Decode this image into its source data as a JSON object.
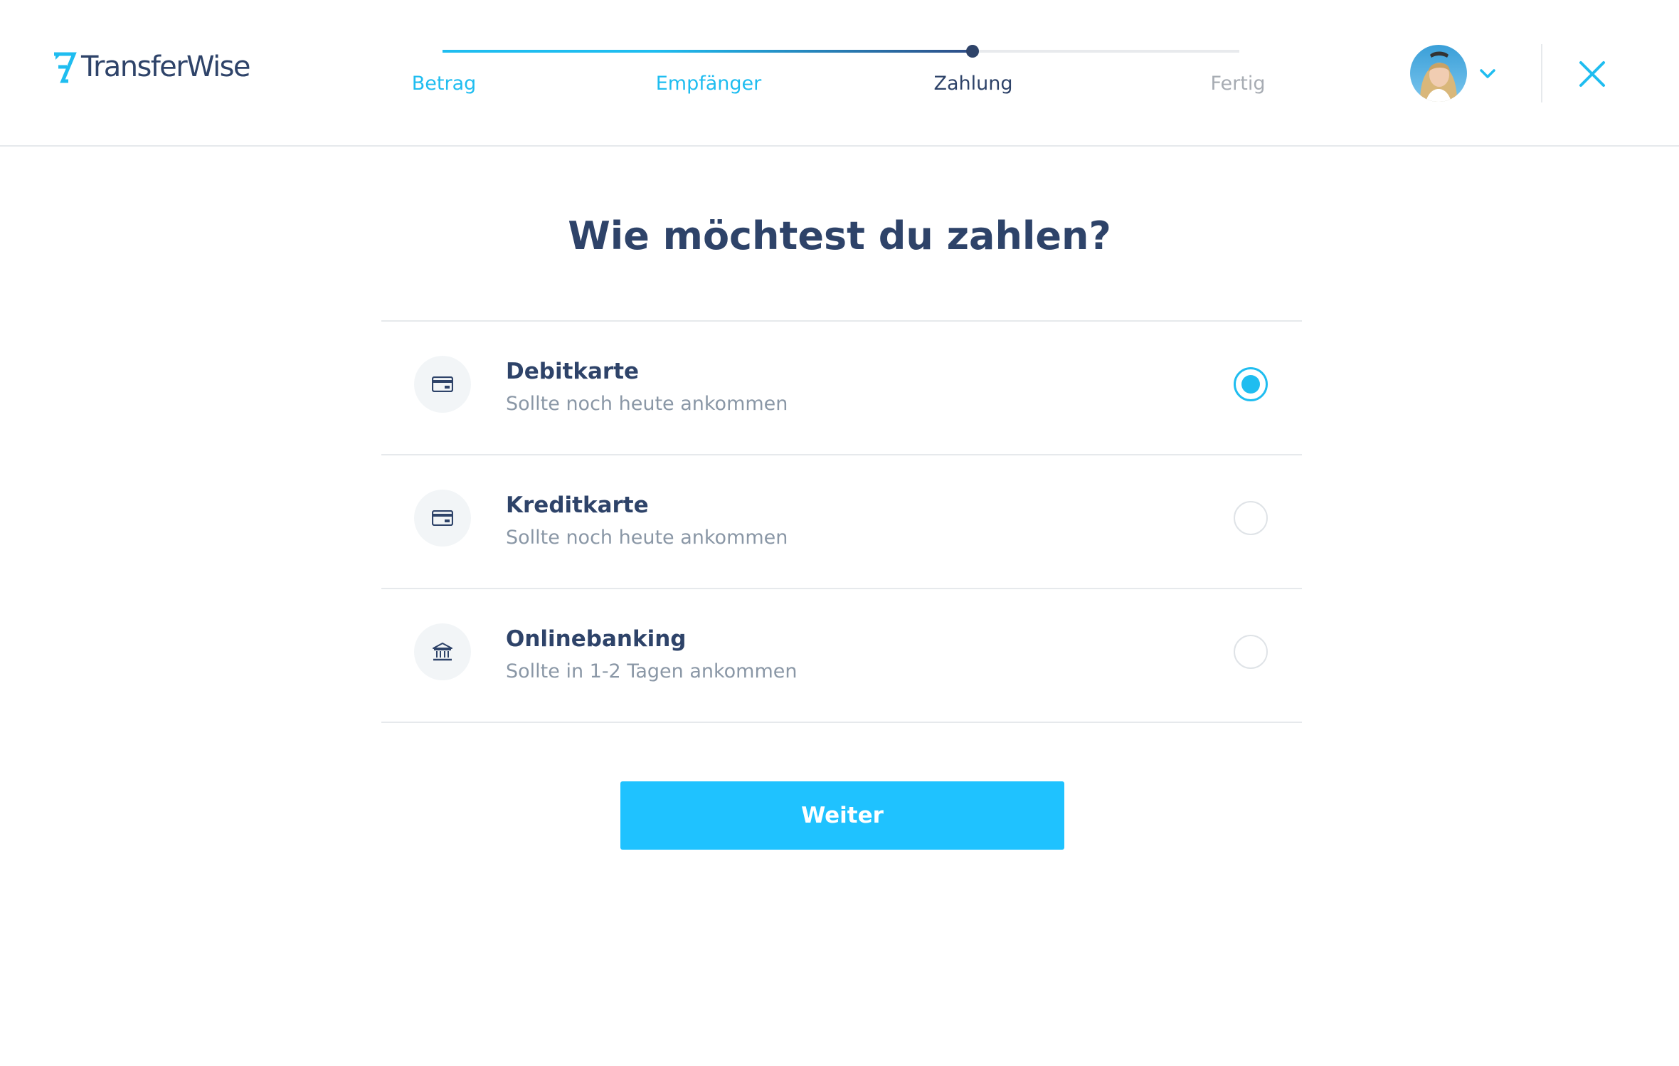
{
  "brand": {
    "name": "TransferWise",
    "accent_color": "#1fc2ff",
    "primary_text_color": "#2e4369"
  },
  "stepper": {
    "steps": [
      {
        "label": "Betrag",
        "state": "done"
      },
      {
        "label": "Empfänger",
        "state": "done"
      },
      {
        "label": "Zahlung",
        "state": "current"
      },
      {
        "label": "Fertig",
        "state": "upcoming"
      }
    ]
  },
  "account": {
    "avatar_icon": "user-photo",
    "menu_icon": "chevron-down-icon"
  },
  "close_icon": "close-icon",
  "main": {
    "title": "Wie möchtest du zahlen?",
    "payment_options": [
      {
        "icon": "card-icon",
        "title": "Debitkarte",
        "subtitle": "Sollte noch heute ankommen",
        "selected": true
      },
      {
        "icon": "card-icon",
        "title": "Kreditkarte",
        "subtitle": "Sollte noch heute ankommen",
        "selected": false
      },
      {
        "icon": "bank-icon",
        "title": "Onlinebanking",
        "subtitle": "Sollte in 1-2 Tagen ankommen",
        "selected": false
      }
    ],
    "continue_label": "Weiter"
  }
}
